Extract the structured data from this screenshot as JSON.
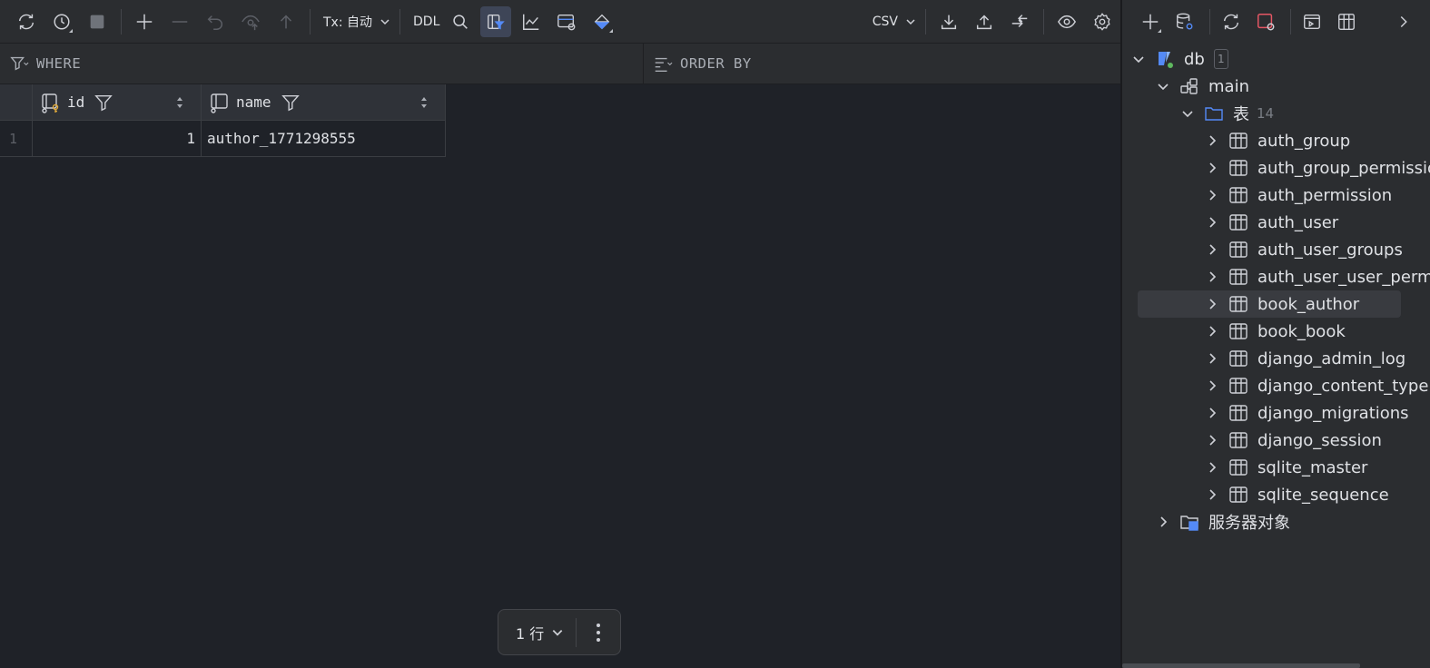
{
  "toolbar": {
    "tx_label": "Tx: 自动",
    "ddl_label": "DDL",
    "export_format": "CSV"
  },
  "filter": {
    "where_label": "WHERE",
    "order_label": "ORDER BY"
  },
  "grid": {
    "columns": [
      {
        "name": "id"
      },
      {
        "name": "name"
      }
    ],
    "rows": [
      {
        "num": "1",
        "id": "1",
        "name": "author_1771298555"
      }
    ]
  },
  "pager": {
    "rows_label": "1 行"
  },
  "tree": {
    "db_name": "db",
    "db_badge": "1",
    "schema": "main",
    "tables_folder": "表",
    "tables_count": "14",
    "tables": [
      "auth_group",
      "auth_group_permissions",
      "auth_permission",
      "auth_user",
      "auth_user_groups",
      "auth_user_user_permissions",
      "book_author",
      "book_book",
      "django_admin_log",
      "django_content_type",
      "django_migrations",
      "django_session",
      "sqlite_master",
      "sqlite_sequence"
    ],
    "server_objects": "服务器对象"
  },
  "colors": {
    "background": "#1f2228",
    "panel": "#2b2d30",
    "accent_blue": "#548af7",
    "key_gold": "#e0a93a"
  }
}
